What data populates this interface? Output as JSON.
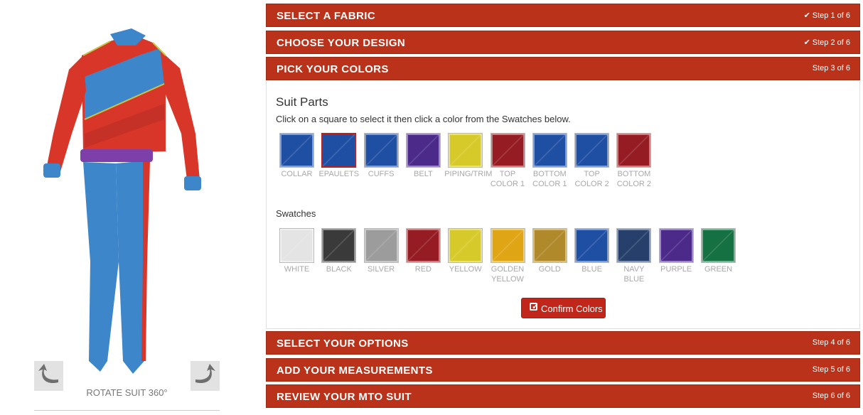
{
  "viewer": {
    "rotate_label": "ROTATE SUIT 360°",
    "rotate_left_icon": "rotate-left-arrow-icon",
    "rotate_right_icon": "rotate-right-arrow-icon"
  },
  "steps": [
    {
      "title": "SELECT A FABRIC",
      "step": "Step 1 of 6",
      "done": true
    },
    {
      "title": "CHOOSE YOUR DESIGN",
      "step": "Step 2 of 6",
      "done": true
    },
    {
      "title": "PICK YOUR COLORS",
      "step": "Step 3 of 6",
      "done": false
    },
    {
      "title": "SELECT YOUR OPTIONS",
      "step": "Step 4 of 6",
      "done": false
    },
    {
      "title": "ADD YOUR MEASUREMENTS",
      "step": "Step 5 of 6",
      "done": false
    },
    {
      "title": "REVIEW YOUR MTO SUIT",
      "step": "Step 6 of 6",
      "done": false
    }
  ],
  "colors_step": {
    "suit_parts_heading": "Suit Parts",
    "instruction": "Click on a square to select it then click a color from the Swatches below.",
    "swatches_heading": "Swatches",
    "confirm_label": "Confirm Colors",
    "suit_parts": [
      {
        "label": "COLLAR",
        "color": "#1f4fa3",
        "selected": false
      },
      {
        "label": "EPAULETS",
        "color": "#1f4fa3",
        "selected": true
      },
      {
        "label": "CUFFS",
        "color": "#1f4fa3",
        "selected": false
      },
      {
        "label": "BELT",
        "color": "#4b2a8a",
        "selected": false
      },
      {
        "label": "PIPING/TRIM",
        "color": "#d6c92a",
        "selected": false
      },
      {
        "label": "TOP COLOR 1",
        "color": "#941c22",
        "selected": false
      },
      {
        "label": "BOTTOM COLOR 1",
        "color": "#1f4fa3",
        "selected": false
      },
      {
        "label": "TOP COLOR 2",
        "color": "#1f4fa3",
        "selected": false
      },
      {
        "label": "BOTTOM COLOR 2",
        "color": "#941c22",
        "selected": false
      }
    ],
    "swatches": [
      {
        "label": "WHITE",
        "color": "#e4e4e4"
      },
      {
        "label": "BLACK",
        "color": "#3a3a3a"
      },
      {
        "label": "SILVER",
        "color": "#9c9c9c"
      },
      {
        "label": "RED",
        "color": "#941c22"
      },
      {
        "label": "YELLOW",
        "color": "#d6c92a"
      },
      {
        "label": "GOLDEN YELLOW",
        "color": "#dfa514"
      },
      {
        "label": "GOLD",
        "color": "#b08a2a"
      },
      {
        "label": "BLUE",
        "color": "#1f4fa3"
      },
      {
        "label": "NAVY BLUE",
        "color": "#263f6b"
      },
      {
        "label": "PURPLE",
        "color": "#4b2a8a"
      },
      {
        "label": "GREEN",
        "color": "#157042"
      }
    ]
  },
  "colors": {
    "bar_red": "#b93219",
    "suit_red": "#d9362a",
    "suit_blue": "#3d86c9",
    "suit_purple": "#7d3fa8",
    "piping": "#c7c44a"
  }
}
